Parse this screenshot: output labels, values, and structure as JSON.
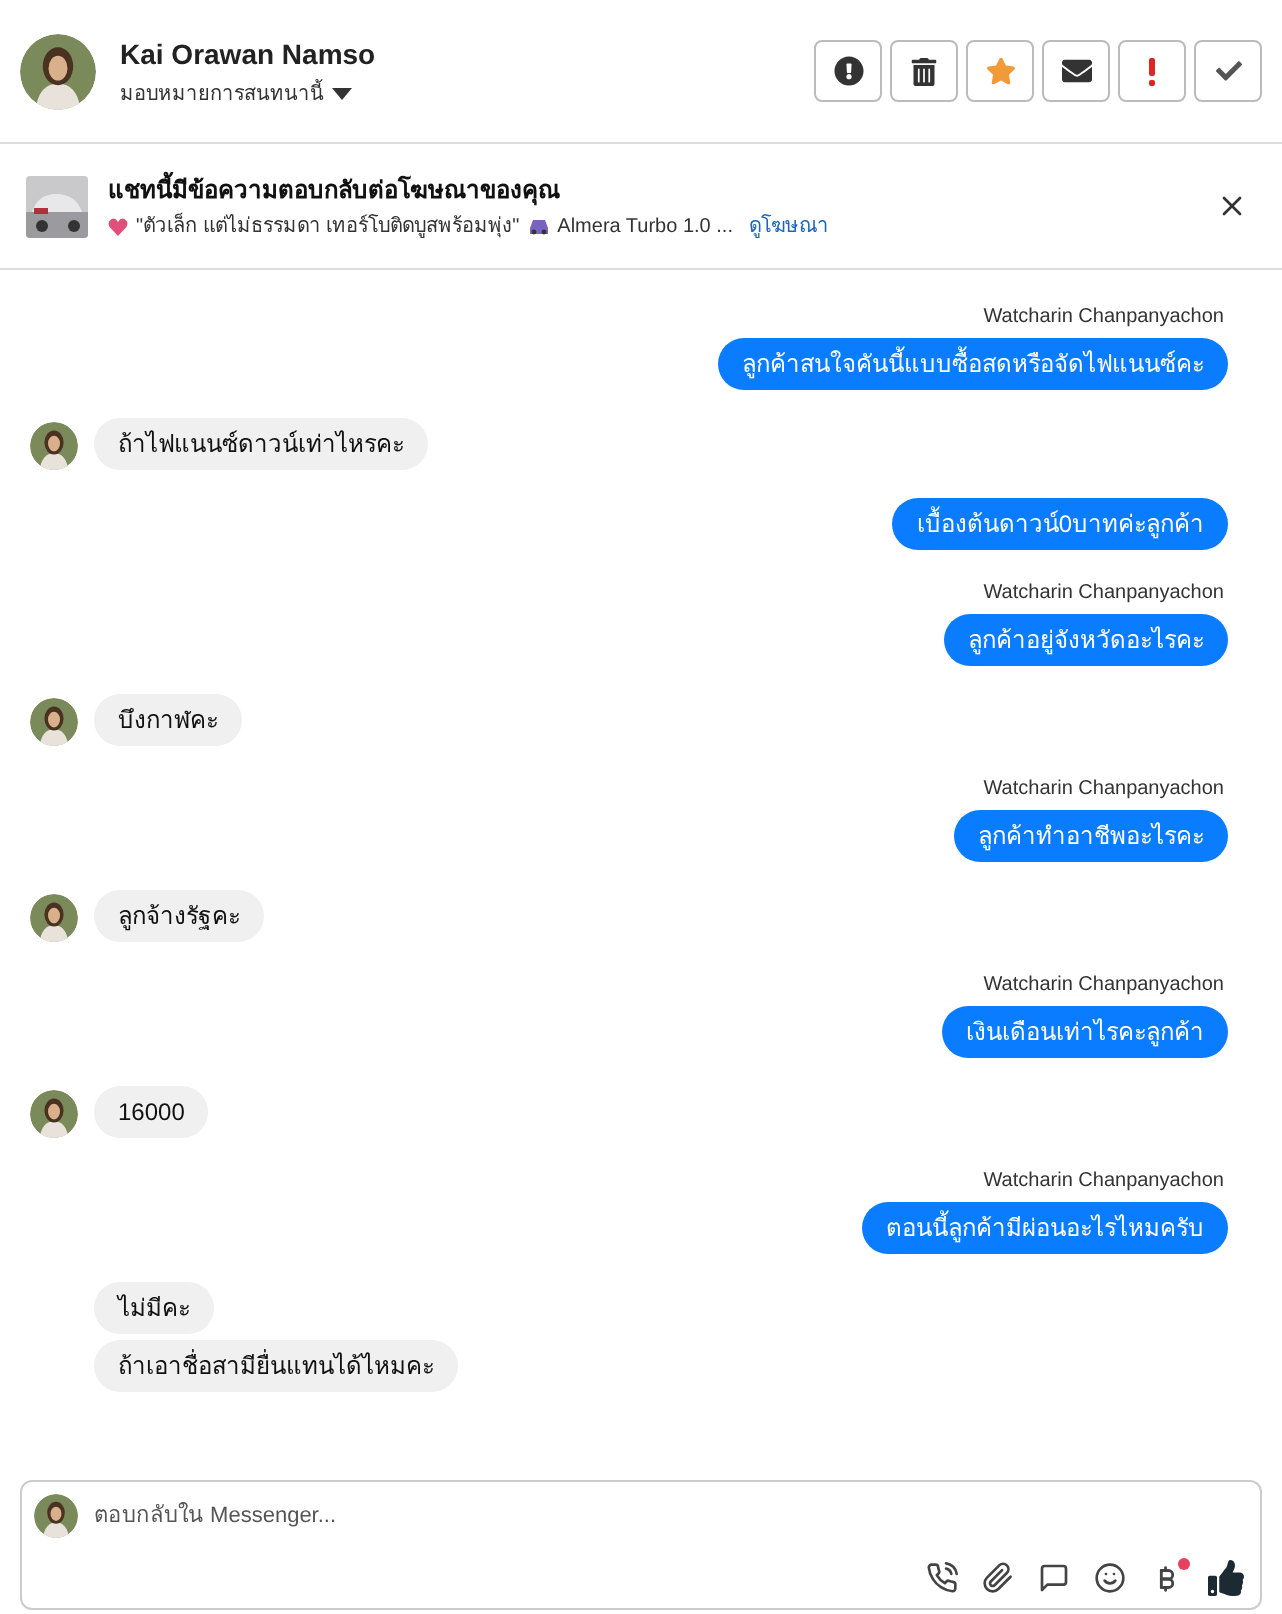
{
  "header": {
    "name": "Kai Orawan Namso",
    "assign_label": "มอบหมายการสนทนานี้",
    "actions": [
      {
        "kind": "spam"
      },
      {
        "kind": "delete"
      },
      {
        "kind": "star"
      },
      {
        "kind": "unread"
      },
      {
        "kind": "important"
      },
      {
        "kind": "done"
      }
    ]
  },
  "ad_banner": {
    "title": "แชทนี้มีข้อความตอบกลับต่อโฆษณาของคุณ",
    "snippet": "\"ตัวเล็ก แต่ไม่ธรรมดา เทอร์โบติดบูสพร้อมพุ่ง\"",
    "car_text": "Almera Turbo 1.0 ...",
    "link": "ดูโฆษณา"
  },
  "turns": [
    {
      "kind": "sent",
      "sender": "Watcharin Chanpanyachon",
      "messages": [
        "ลูกค้าสนใจคันนี้แบบซื้อสดหรือจัดไฟแนนซ์คะ"
      ]
    },
    {
      "kind": "received",
      "messages": [
        "ถ้าไฟแนนซ์ดาวน์เท่าไหรคะ"
      ]
    },
    {
      "kind": "sent",
      "messages": [
        "เบื้องต้นดาวน์0บาทค่ะลูกค้า"
      ]
    },
    {
      "kind": "sent",
      "sender": "Watcharin Chanpanyachon",
      "messages": [
        "ลูกค้าอยู่จังหวัดอะไรคะ"
      ]
    },
    {
      "kind": "received",
      "messages": [
        "บึงกาฬคะ"
      ]
    },
    {
      "kind": "sent",
      "sender": "Watcharin Chanpanyachon",
      "messages": [
        "ลูกค้าทำอาชีพอะไรคะ"
      ]
    },
    {
      "kind": "received",
      "messages": [
        "ลูกจ้างรัฐคะ"
      ]
    },
    {
      "kind": "sent",
      "sender": "Watcharin Chanpanyachon",
      "messages": [
        "เงินเดือนเท่าไรคะลูกค้า"
      ]
    },
    {
      "kind": "received",
      "messages": [
        "16000"
      ]
    },
    {
      "kind": "sent",
      "sender": "Watcharin Chanpanyachon",
      "messages": [
        "ตอนนี้ลูกค้ามีผ่อนอะไรไหมครับ"
      ]
    },
    {
      "kind": "received",
      "messages": [
        "ไม่มีคะ",
        "ถ้าเอาชื่อสามียื่นแทนได้ไหมคะ"
      ]
    }
  ],
  "composer": {
    "placeholder": "ตอบกลับใน Messenger..."
  }
}
